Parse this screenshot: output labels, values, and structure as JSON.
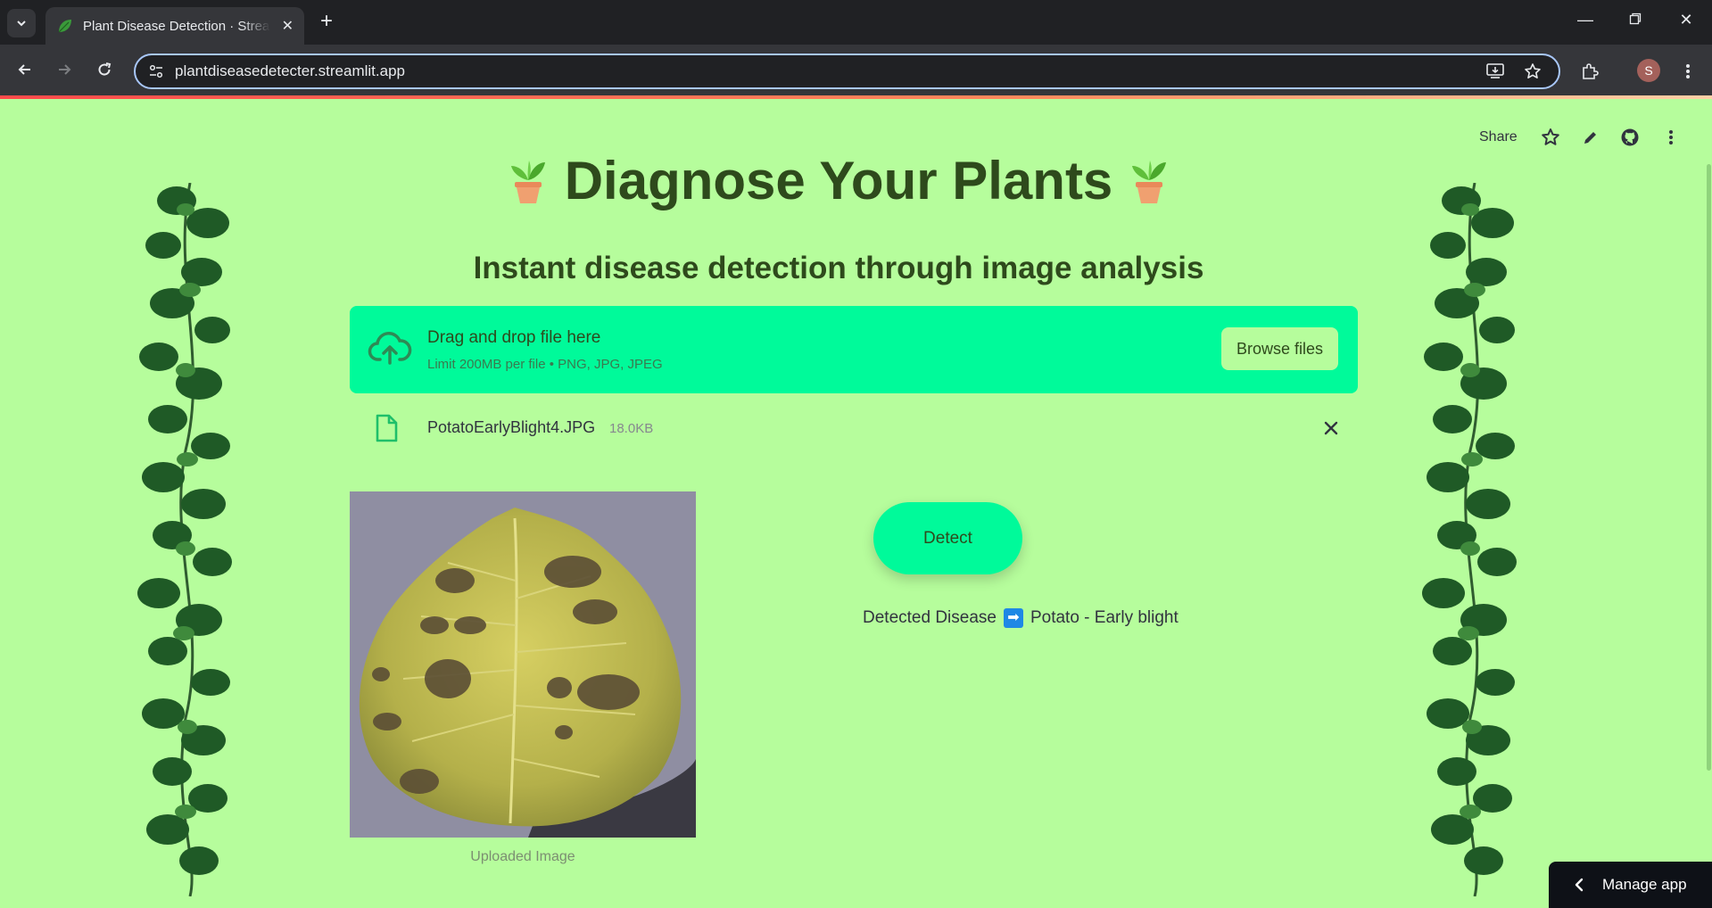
{
  "browser": {
    "tab_title": "Plant Disease Detection · Streamlit",
    "url": "plantdiseasedetecter.streamlit.app",
    "profile_initial": "S"
  },
  "streamlit_header": {
    "share_label": "Share"
  },
  "main": {
    "title": "Diagnose Your Plants",
    "subtitle": "Instant disease detection through image analysis"
  },
  "uploader": {
    "drop_title": "Drag and drop file here",
    "drop_limit": "Limit 200MB per file • PNG, JPG, JPEG",
    "browse_label": "Browse files"
  },
  "uploaded_file": {
    "name": "PotatoEarlyBlight4.JPG",
    "size": "18.0KB"
  },
  "image": {
    "caption": "Uploaded Image"
  },
  "detect": {
    "button_label": "Detect",
    "result_prefix": "Detected Disease",
    "result_value": "Potato - Early blight"
  },
  "manage_app": {
    "label": "Manage app"
  },
  "colors": {
    "page_bg": "#b6fd9c",
    "accent": "#00fa9a",
    "heading": "#2e4a1c"
  }
}
